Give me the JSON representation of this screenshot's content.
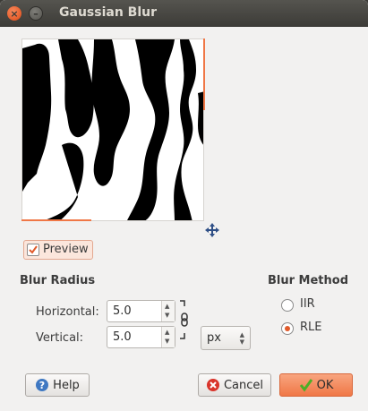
{
  "window": {
    "title": "Gaussian Blur",
    "close_glyph": "×",
    "minimize_glyph": "–"
  },
  "preview": {
    "label": "Preview",
    "checked": true
  },
  "blur_radius": {
    "title": "Blur Radius",
    "horizontal_label": "Horizontal:",
    "horizontal_value": "5.0",
    "vertical_label": "Vertical:",
    "vertical_value": "5.0",
    "unit": "px",
    "chained": true
  },
  "blur_method": {
    "title": "Blur Method",
    "options": [
      {
        "label": "IIR",
        "selected": false
      },
      {
        "label": "RLE",
        "selected": true
      }
    ]
  },
  "buttons": {
    "help": "Help",
    "cancel": "Cancel",
    "ok": "OK"
  },
  "icons": {
    "spin_up": "▲",
    "spin_down": "▼",
    "help_icon": "?",
    "cancel_icon": "×",
    "ok_icon": "✓"
  },
  "colors": {
    "accent": "#f07746",
    "titlebar": "#3c3b37",
    "window_bg": "#f2f1f0",
    "radio_selected": "#e05a2b",
    "help_blue": "#3f78c2",
    "cancel_red": "#d9342b",
    "ok_green": "#4caf27"
  }
}
